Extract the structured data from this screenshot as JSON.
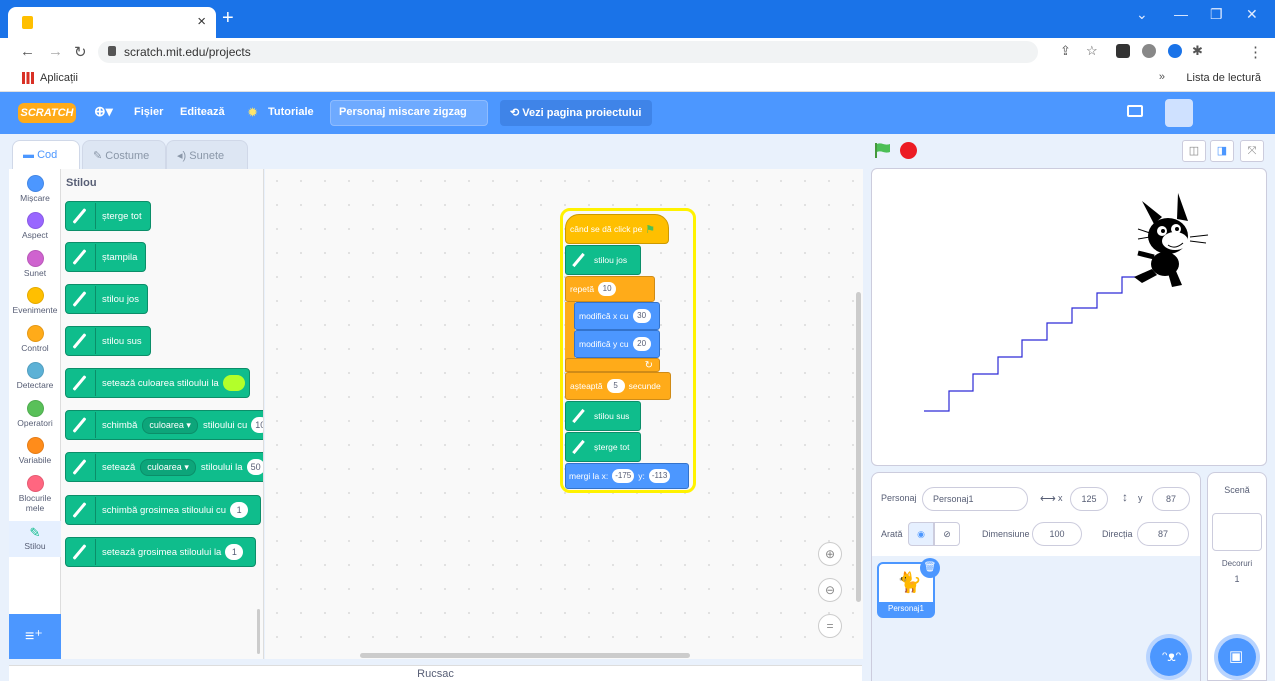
{
  "browser": {
    "tab_close": "×",
    "new_tab": "+",
    "url": "scratch.mit.edu/projects",
    "apps_label": "Aplicații",
    "reading_list": "Lista de lectură",
    "bookmark_more": "»"
  },
  "menu": {
    "logo": "SCRATCH",
    "file": "Fișier",
    "edit": "Editează",
    "tutorials": "Tutoriale",
    "project_name": "Personaj miscare zigzag",
    "see_project": "Vezi pagina proiectului"
  },
  "tabs": {
    "code": "Cod",
    "costumes": "Costume",
    "sounds": "Sunete"
  },
  "categories": [
    {
      "label": "Mișcare",
      "color": "#4c97ff"
    },
    {
      "label": "Aspect",
      "color": "#9966ff"
    },
    {
      "label": "Sunet",
      "color": "#cf63cf"
    },
    {
      "label": "Evenimente",
      "color": "#ffbf00"
    },
    {
      "label": "Control",
      "color": "#ffab19"
    },
    {
      "label": "Detectare",
      "color": "#5cb1d6"
    },
    {
      "label": "Operatori",
      "color": "#59c059"
    },
    {
      "label": "Variabile",
      "color": "#ff8c1a"
    },
    {
      "label": "Blocurile mele",
      "color": "#ff6680"
    },
    {
      "label": "Stilou",
      "color": "#0fbd8c"
    }
  ],
  "palette": {
    "title": "Stilou",
    "clear": "șterge tot",
    "stamp": "ștampila",
    "pen_down": "stilou jos",
    "pen_up": "stilou sus",
    "set_color": "setează culoarea stiloului la",
    "change_param_a": "schimbă",
    "change_param_dd": "culoarea",
    "change_param_b": "stiloului cu",
    "change_param_val": "10",
    "set_param_a": "setează",
    "set_param_dd": "culoarea",
    "set_param_b": "stiloului la",
    "set_param_val": "50",
    "change_size": "schimbă grosimea stiloului cu",
    "change_size_val": "1",
    "set_size": "setează grosimea stiloului la",
    "set_size_val": "1"
  },
  "script": {
    "when_flag": "când se dă click pe",
    "pen_down": "stilou jos",
    "repeat": "repetă",
    "repeat_val": "10",
    "change_x": "modifică x cu",
    "change_x_val": "30",
    "change_y": "modifică y cu",
    "change_y_val": "20",
    "wait_a": "așteaptă",
    "wait_val": "5",
    "wait_b": "secunde",
    "pen_up": "stilou sus",
    "clear": "șterge tot",
    "goto_a": "mergi la x:",
    "goto_x": "-175",
    "goto_y_lbl": "y:",
    "goto_y": "-113"
  },
  "backpack": "Rucsac",
  "sprite_info": {
    "sprite_label": "Personaj",
    "sprite_name": "Personaj1",
    "x_label": "x",
    "x": "125",
    "y_label": "y",
    "y": "87",
    "show_label": "Arată",
    "size_label": "Dimensiune",
    "size": "100",
    "direction_label": "Direcția",
    "direction": "87"
  },
  "sprite_thumb": "Personaj1",
  "scene": {
    "title": "Scenă",
    "backdrops_label": "Decoruri",
    "backdrops_count": "1"
  },
  "colors": {
    "scratch_blue": "#4c97ff",
    "pen_green": "#0fbd8c",
    "highlight": "#fff200",
    "chrome_blue": "#1a73e8"
  }
}
